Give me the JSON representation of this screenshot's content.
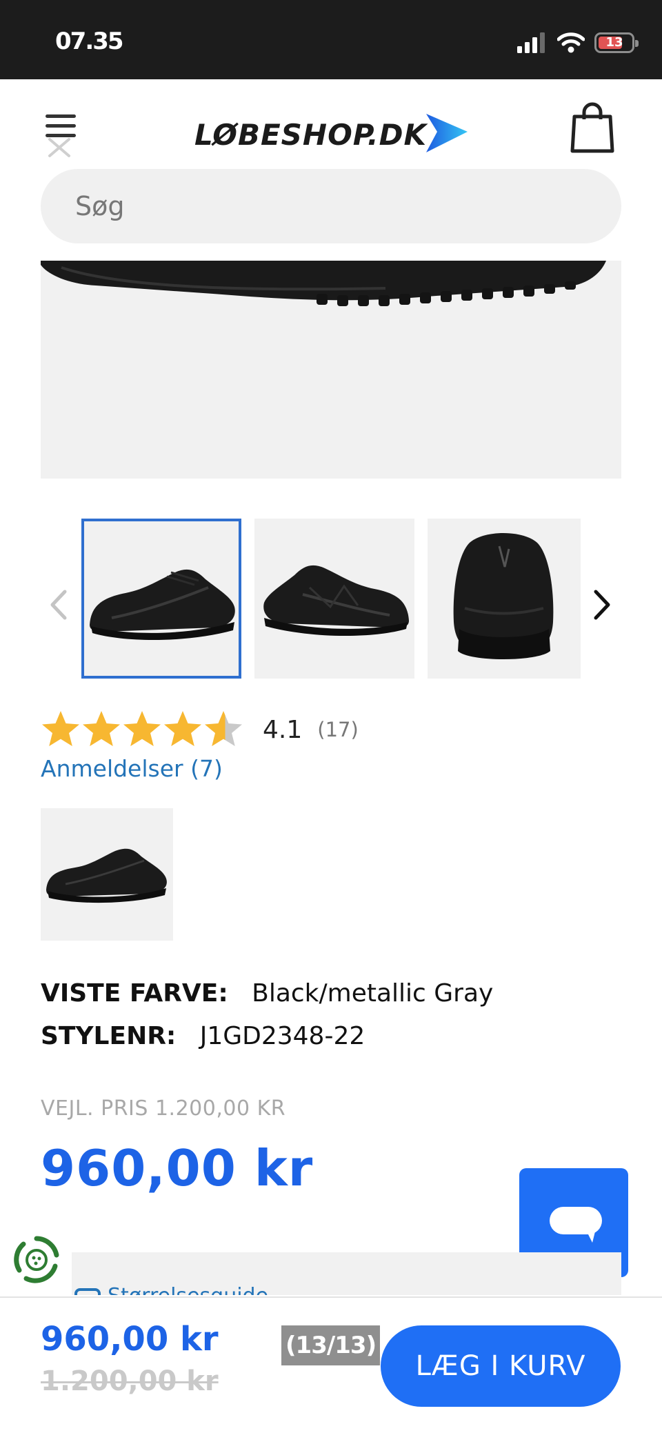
{
  "status_bar": {
    "time": "07.35",
    "battery": "13"
  },
  "header": {
    "brand": "LØBESHOP.DK",
    "search_placeholder": "Søg",
    "colors": {
      "brand_arrow_start": "#1e5be0",
      "brand_arrow_end": "#35c6f4"
    }
  },
  "gallery": {
    "selected_thumb": 1,
    "thumbnails": [
      {
        "view": "side-left"
      },
      {
        "view": "side-right"
      },
      {
        "view": "heel"
      }
    ]
  },
  "rating": {
    "value": "4.1",
    "count": "(17)",
    "stars_filled_fraction": 0.82,
    "reviews_link": "Anmeldelser (7)"
  },
  "attributes": {
    "color_label": "VISTE FARVE:",
    "color_value": "Black/metallic Gray",
    "style_label": "STYLENR:",
    "style_value": "J1GD2348-22"
  },
  "pricing": {
    "rrp": "VEJL. PRIS 1.200,00 KR",
    "price": "960,00 kr"
  },
  "size_guide": {
    "label": "Størrelsesguide"
  },
  "sticky_bar": {
    "price": "960,00 kr",
    "old_price": "1.200,00 kr",
    "page_counter": "(13/13)",
    "add_to_cart": "LÆG I KURV"
  },
  "colors": {
    "accent": "#1f6ff5",
    "price": "#1d63e6",
    "link": "#2474b8",
    "star": "#f7b731",
    "selected_border": "#2f6fcf"
  }
}
